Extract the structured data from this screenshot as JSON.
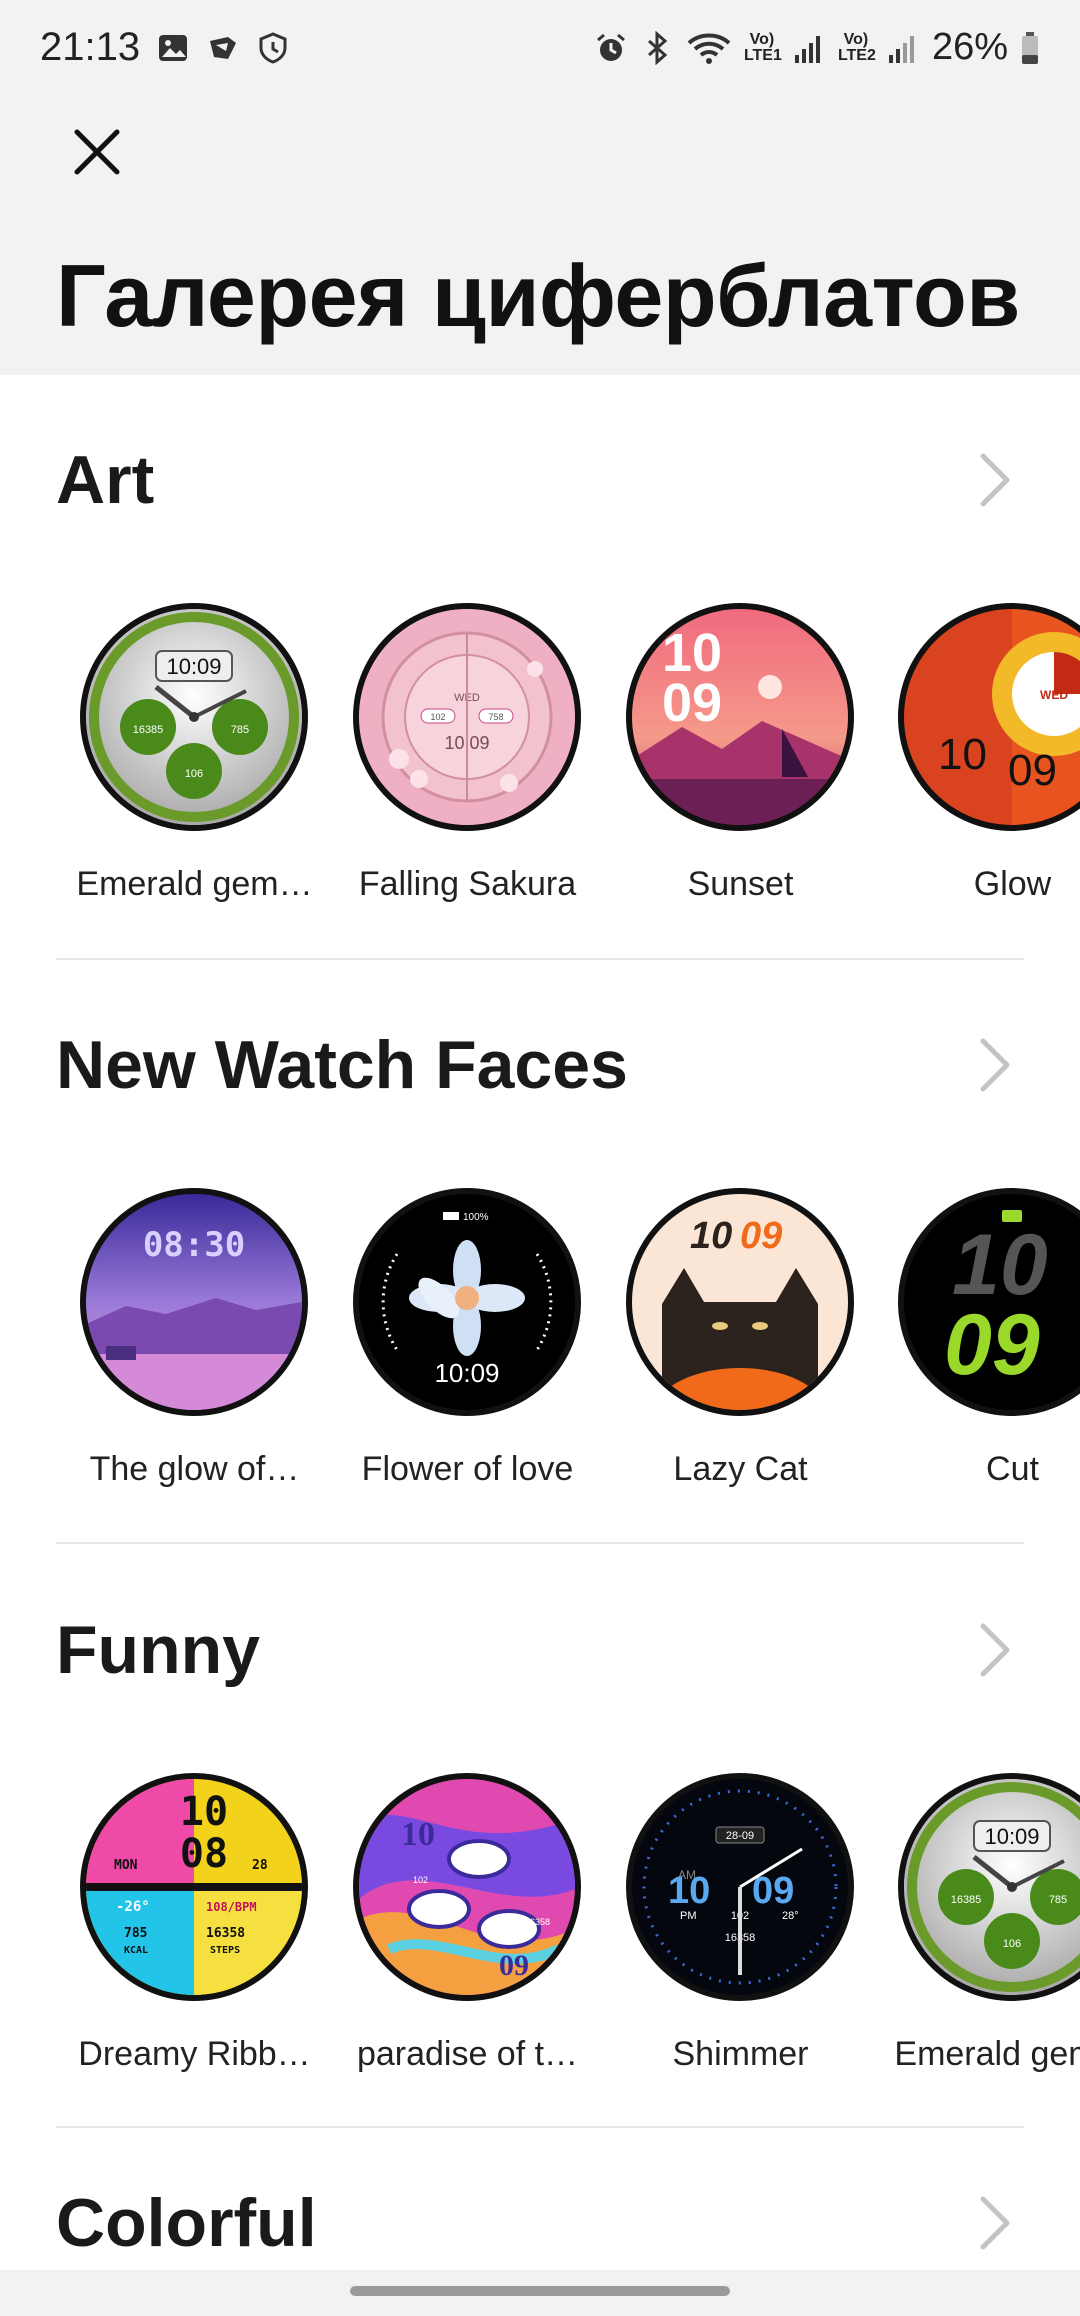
{
  "status_bar": {
    "time": "21:13",
    "battery": "26%",
    "icons_left": [
      "image-icon",
      "cast-icon",
      "shield-icon"
    ],
    "icons_right": [
      "alarm-icon",
      "bluetooth-icon",
      "wifi-icon",
      "volte-lte1-icon",
      "signal-icon",
      "volte-lte2-icon",
      "signal-icon",
      "battery-icon"
    ],
    "volte1_label": "Vo) LTE1",
    "volte2_label": "Vo) LTE2"
  },
  "header": {
    "close_icon": "close-icon",
    "title": "Галерея циферблатов"
  },
  "sections": [
    {
      "title": "Art",
      "faces": [
        {
          "label": "Emerald gem…",
          "dial_time": "10:09",
          "left_value": "16385",
          "right_value": "785",
          "bottom_value": "106"
        },
        {
          "label": "Falling Sakura",
          "day": "WED",
          "time": "10:09",
          "left_value": "102",
          "right_value": "758"
        },
        {
          "label": "Sunset",
          "hour": "10",
          "minute": "09"
        },
        {
          "label": "Glow",
          "day": "WED",
          "hour": "10",
          "minute": "09"
        }
      ]
    },
    {
      "title": "New Watch Faces",
      "faces": [
        {
          "label": "The glow of…",
          "time": "08:30"
        },
        {
          "label": "Flower of love",
          "battery": "100%",
          "time": "10:09"
        },
        {
          "label": "Lazy Cat",
          "hour": "10",
          "minute": "09"
        },
        {
          "label": "Cut",
          "hour": "10",
          "minute": "09"
        }
      ]
    },
    {
      "title": "Funny",
      "faces": [
        {
          "label": "Dreamy Ribb…",
          "hour": "10",
          "minute": "08",
          "day": "MON",
          "date": "28",
          "temp": "-26°",
          "kcal": "785",
          "kcal_label": "KCAL",
          "bpm": "108/BPM",
          "steps": "16358",
          "steps_label": "STEPS"
        },
        {
          "label": "paradise of t…",
          "hour": "10",
          "minute": "09",
          "left_value": "102",
          "right_value": "16358"
        },
        {
          "label": "Shimmer",
          "date": "28-09",
          "ampm": "AM",
          "hour": "10",
          "minute": "09",
          "pm": "PM",
          "value": "102",
          "temp": "28°",
          "steps": "16358"
        },
        {
          "label": "Emerald gem…",
          "dial_time": "10:09",
          "left_value": "16385",
          "right_value": "785",
          "bottom_value": "106"
        }
      ]
    },
    {
      "title": "Colorful",
      "faces": []
    }
  ],
  "colors": {
    "header_bg": "#f2f2f2",
    "page_bg": "#ffffff",
    "divider": "#e6e6e6",
    "chevron": "#c4c4c4"
  }
}
